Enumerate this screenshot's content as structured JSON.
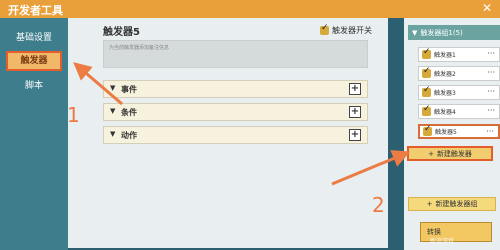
{
  "titlebar": {
    "title": "开发者工具",
    "close": "✕"
  },
  "sidebar": {
    "items": [
      {
        "label": "基础设置"
      },
      {
        "label": "触发器"
      },
      {
        "label": "脚本"
      }
    ]
  },
  "main": {
    "title": "触发器5",
    "switch_label": "触发器开关",
    "note_placeholder": "为当前触发器添加备注信息",
    "sections": [
      {
        "label": "事件"
      },
      {
        "label": "条件"
      },
      {
        "label": "动作"
      }
    ]
  },
  "right_panel": {
    "group_label": "触发器组1(5)",
    "triggers": [
      {
        "label": "触发器1"
      },
      {
        "label": "触发器2"
      },
      {
        "label": "触发器3"
      },
      {
        "label": "触发器4"
      },
      {
        "label": "触发器5"
      }
    ],
    "new_trigger": "新建触发器",
    "new_group": "新建触发器组",
    "bottom_button": "转换"
  },
  "annotations": {
    "one": "1",
    "two": "2"
  },
  "watermark": "新浪游戏",
  "colors": {
    "title_bar": "#e9a03a",
    "sidebar": "#3d7d8c",
    "highlight": "#e35e2c",
    "annotation": "#ec7b44"
  }
}
